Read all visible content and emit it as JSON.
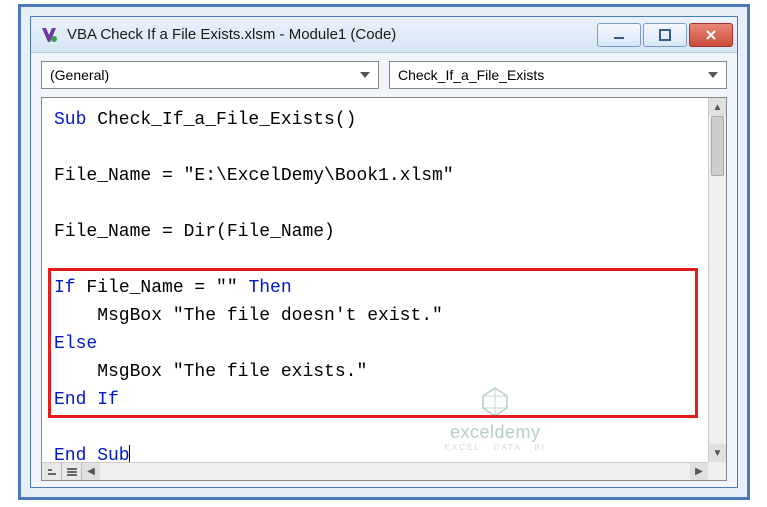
{
  "window": {
    "title": "VBA Check If a File Exists.xlsm - Module1 (Code)"
  },
  "dropdowns": {
    "left": "(General)",
    "right": "Check_If_a_File_Exists"
  },
  "code": {
    "line1_kw": "Sub",
    "line1_rest": " Check_If_a_File_Exists()",
    "line2": "",
    "line3": "File_Name = \"E:\\ExcelDemy\\Book1.xlsm\"",
    "line4": "",
    "line5": "File_Name = Dir(File_Name)",
    "line6": "",
    "line7_kw1": "If",
    "line7_mid": " File_Name = \"\" ",
    "line7_kw2": "Then",
    "line8": "    MsgBox \"The file doesn't exist.\"",
    "line9_kw": "Else",
    "line10": "    MsgBox \"The file exists.\"",
    "line11_kw": "End If",
    "line12": "",
    "line13_kw": "End Sub"
  },
  "watermark": {
    "brand": "exceldemy",
    "tag": "EXCEL · DATA · BI"
  }
}
